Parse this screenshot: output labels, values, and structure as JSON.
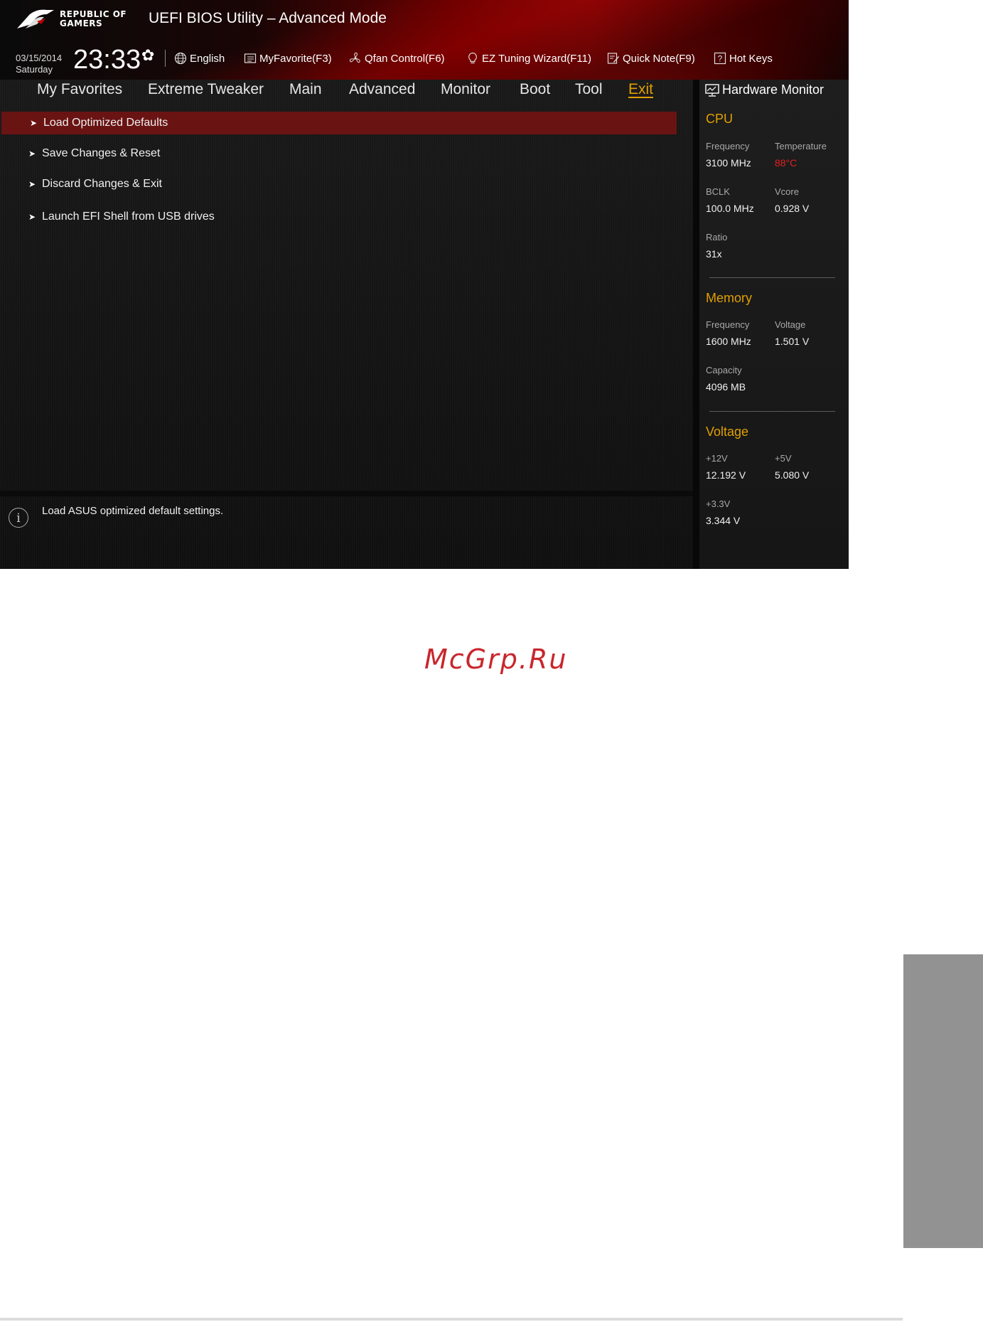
{
  "header": {
    "logo_line1": "REPUBLIC OF",
    "logo_line2": "GAMERS",
    "title": "UEFI BIOS Utility – Advanced Mode",
    "date": "03/15/2014",
    "day": "Saturday",
    "time": "23:33"
  },
  "toolbar": [
    {
      "label": "English",
      "icon": "globe-icon"
    },
    {
      "label": "MyFavorite(F3)",
      "icon": "list-icon"
    },
    {
      "label": "Qfan Control(F6)",
      "icon": "fan-icon"
    },
    {
      "label": "EZ Tuning Wizard(F11)",
      "icon": "lightbulb-icon"
    },
    {
      "label": "Quick Note(F9)",
      "icon": "note-icon"
    },
    {
      "label": "Hot Keys",
      "icon": "question-icon"
    }
  ],
  "menu": [
    {
      "label": "My Favorites",
      "active": false
    },
    {
      "label": "Extreme Tweaker",
      "active": false
    },
    {
      "label": "Main",
      "active": false
    },
    {
      "label": "Advanced",
      "active": false
    },
    {
      "label": "Monitor",
      "active": false
    },
    {
      "label": "Boot",
      "active": false
    },
    {
      "label": "Tool",
      "active": false
    },
    {
      "label": "Exit",
      "active": true
    }
  ],
  "items": [
    {
      "label": "Load Optimized Defaults",
      "selected": true
    },
    {
      "label": "Save Changes & Reset",
      "selected": false
    },
    {
      "label": "Discard Changes & Exit",
      "selected": false
    },
    {
      "label": "Launch EFI Shell from USB drives",
      "selected": false
    }
  ],
  "help": {
    "text": "Load ASUS optimized default settings."
  },
  "hw": {
    "title": "Hardware Monitor",
    "cpu": {
      "heading": "CPU",
      "freq_label": "Frequency",
      "freq": "3100 MHz",
      "temp_label": "Temperature",
      "temp": "88°C",
      "bclk_label": "BCLK",
      "bclk": "100.0 MHz",
      "vcore_label": "Vcore",
      "vcore": "0.928 V",
      "ratio_label": "Ratio",
      "ratio": "31x"
    },
    "memory": {
      "heading": "Memory",
      "freq_label": "Frequency",
      "freq": "1600 MHz",
      "volt_label": "Voltage",
      "volt": "1.501 V",
      "cap_label": "Capacity",
      "cap": "4096 MB"
    },
    "voltage": {
      "heading": "Voltage",
      "v12_label": "+12V",
      "v12": "12.192 V",
      "v5_label": "+5V",
      "v5": "5.080 V",
      "v33_label": "+3.3V",
      "v33": "3.344 V"
    }
  },
  "colors": {
    "accent": "#e0a000",
    "selection": "#6a1313",
    "hot": "#e02020"
  },
  "watermark": "McGrp.Ru"
}
